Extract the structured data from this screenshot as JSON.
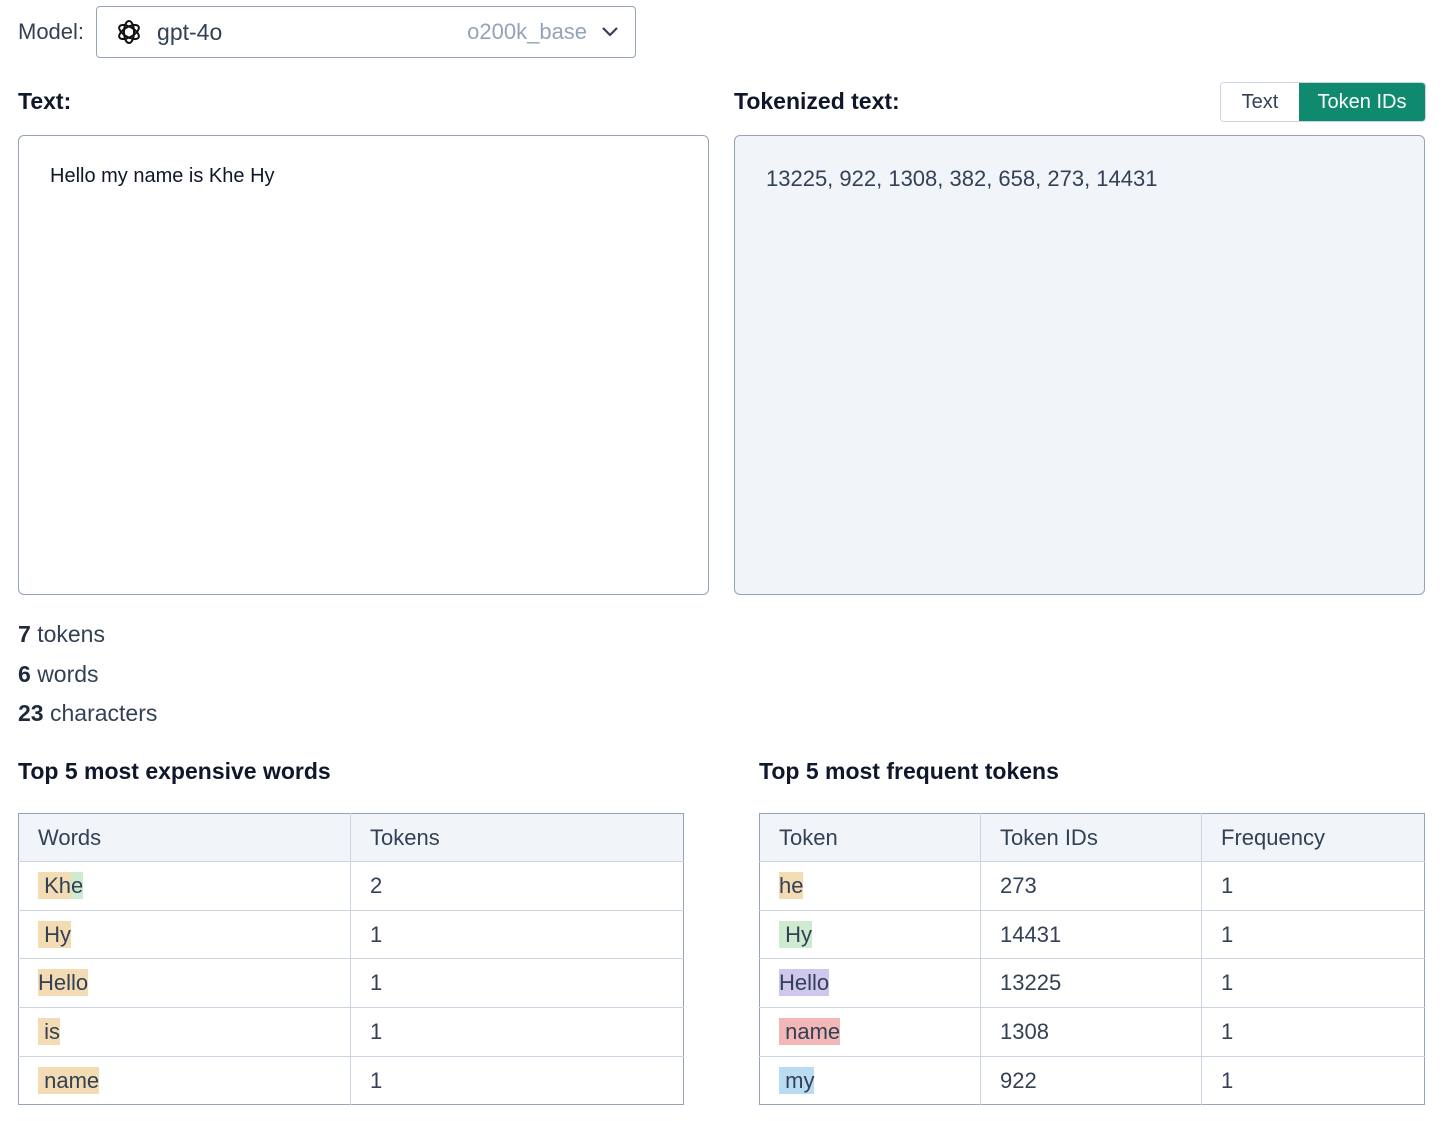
{
  "model": {
    "label": "Model:",
    "name": "gpt-4o",
    "encoding": "o200k_base",
    "logo_icon": "openai-logo-icon",
    "dropdown_icon": "chevron-down-icon"
  },
  "input": {
    "heading": "Text:",
    "value": "Hello my name is Khe Hy"
  },
  "output": {
    "heading": "Tokenized text:",
    "toggle": {
      "text_label": "Text",
      "ids_label": "Token IDs",
      "active": "Token IDs"
    },
    "value": "13225, 922, 1308, 382, 658, 273, 14431"
  },
  "stats": {
    "tokens_count": "7",
    "tokens_label": "tokens",
    "words_count": "6",
    "words_label": "words",
    "chars_count": "23",
    "chars_label": "characters"
  },
  "expensive": {
    "title": "Top 5 most expensive words",
    "headers": [
      "Words",
      "Tokens"
    ],
    "rows": [
      {
        "segments": [
          {
            "text": " ",
            "color": "#f3dcb4"
          },
          {
            "text": "Kh",
            "color": "#f3dcb4"
          },
          {
            "text": "e",
            "color": "#cdeccf"
          }
        ],
        "tokens": "2"
      },
      {
        "segments": [
          {
            "text": " Hy",
            "color": "#f3dcb4"
          }
        ],
        "tokens": "1"
      },
      {
        "segments": [
          {
            "text": "Hello",
            "color": "#f3dcb4"
          }
        ],
        "tokens": "1"
      },
      {
        "segments": [
          {
            "text": " is",
            "color": "#f3dcb4"
          }
        ],
        "tokens": "1"
      },
      {
        "segments": [
          {
            "text": " name",
            "color": "#f3dcb4"
          }
        ],
        "tokens": "1"
      }
    ]
  },
  "frequent": {
    "title": "Top 5 most frequent tokens",
    "headers": [
      "Token",
      "Token IDs",
      "Frequency"
    ],
    "rows": [
      {
        "token": "he",
        "color": "#f3dcb4",
        "id": "273",
        "freq": "1"
      },
      {
        "token": " Hy",
        "color": "#cdeccf",
        "id": "14431",
        "freq": "1"
      },
      {
        "token": "Hello",
        "color": "#cfc7ee",
        "id": "13225",
        "freq": "1"
      },
      {
        "token": " name",
        "color": "#f2b8b8",
        "id": "1308",
        "freq": "1"
      },
      {
        "token": " my",
        "color": "#b9dcf2",
        "id": "922",
        "freq": "1"
      }
    ]
  }
}
